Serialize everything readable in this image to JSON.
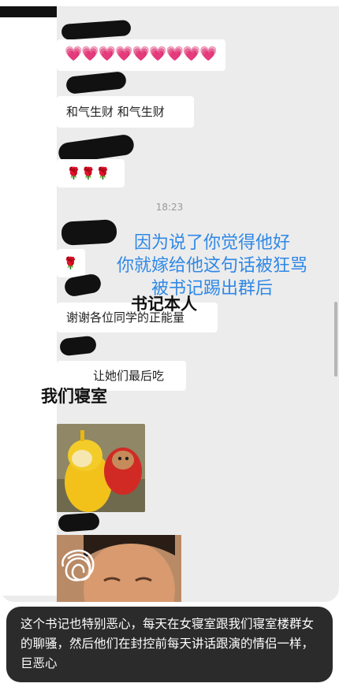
{
  "messages": {
    "m1_hearts": "💗💗💗💗💗💗💗💗💗",
    "m2_text": "和气生财 和气生财",
    "m3_roses": "🌹🌹🌹",
    "timestamp": "18:23",
    "m4_rose": "🌹",
    "m5_text": "谢谢各位同学的正能量",
    "m6_text": "让她们最后吃"
  },
  "annotations": {
    "blue_text_line1": "因为说了你觉得他好",
    "blue_text_line2": "你就嫁给他这句话被狂骂",
    "blue_text_line3": "被书记踢出群后",
    "secretary_label": "书记本人",
    "dorm_label": "我们寝室"
  },
  "caption": {
    "text": "这个书记也特别恶心，每天在女寝室跟我们寝室楼群女的聊骚，然后他们在封控前每天讲话跟演的情侣一样，巨恶心"
  },
  "colors": {
    "blue_annotation": "#2f88e6",
    "chat_background": "#ececec",
    "caption_background": "#2b2b2b"
  }
}
